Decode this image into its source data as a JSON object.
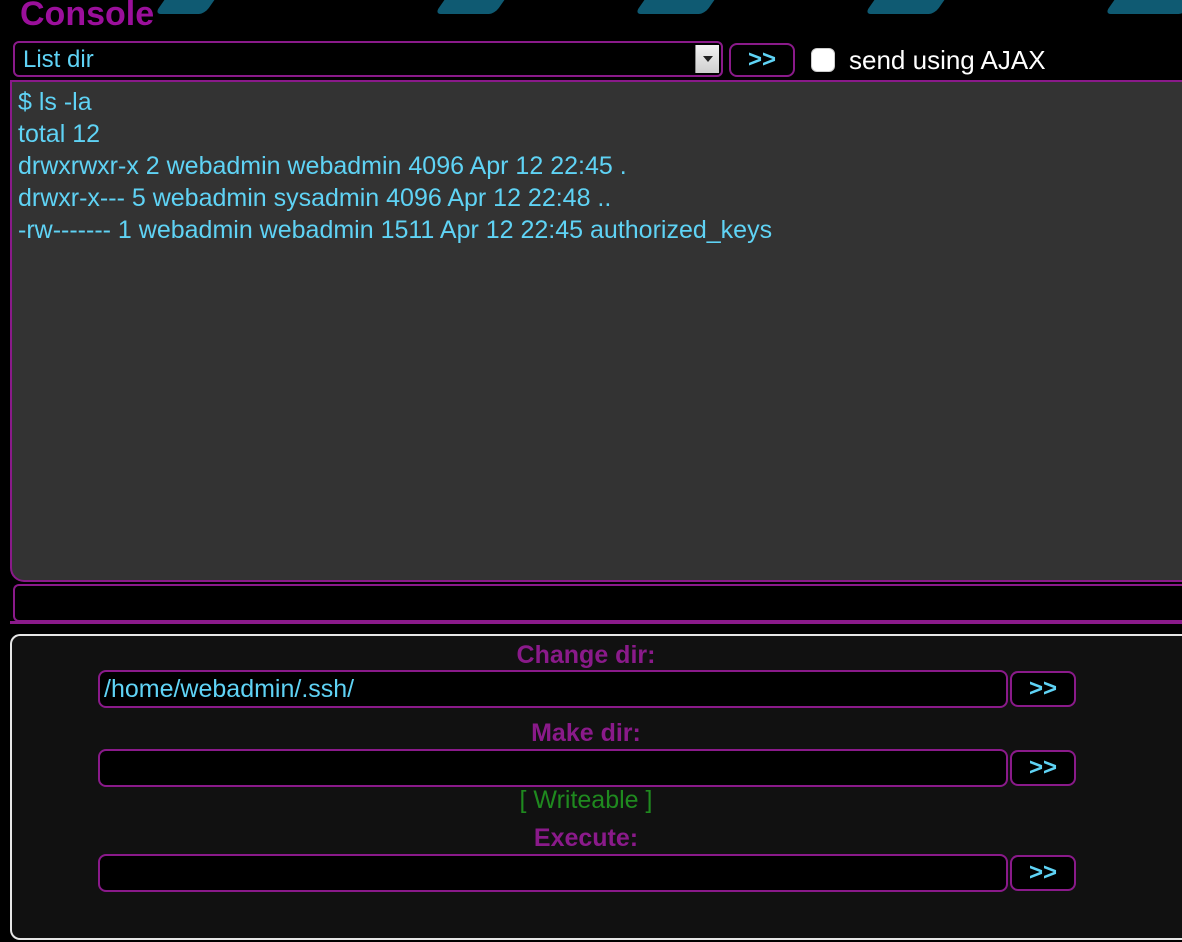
{
  "header": {
    "title": "Console"
  },
  "toolbar": {
    "selected_command": "List dir",
    "go_label": ">>",
    "ajax_label": "send using AJAX",
    "ajax_checked": false
  },
  "output": {
    "lines": [
      "$ ls -la",
      "total 12",
      "drwxrwxr-x 2 webadmin webadmin 4096 Apr 12 22:45 .",
      "drwxr-x--- 5 webadmin sysadmin 4096 Apr 12 22:48 ..",
      "-rw------- 1 webadmin webadmin 1511 Apr 12 22:45 authorized_keys"
    ]
  },
  "command_input": {
    "value": ""
  },
  "panel": {
    "change_dir": {
      "label": "Change dir:",
      "value": "/home/webadmin/.ssh/",
      "button": ">>"
    },
    "make_dir": {
      "label": "Make dir:",
      "value": "",
      "button": ">>"
    },
    "writeable_status": "[ Writeable ]",
    "execute": {
      "label": "Execute:",
      "value": "",
      "button": ">>"
    }
  },
  "colors": {
    "accent_purple": "#8a1a8a",
    "text_cyan": "#5fd3f5",
    "writeable_green": "#1f8a1f",
    "output_bg": "#333333",
    "deco_teal": "#0f5a72"
  }
}
